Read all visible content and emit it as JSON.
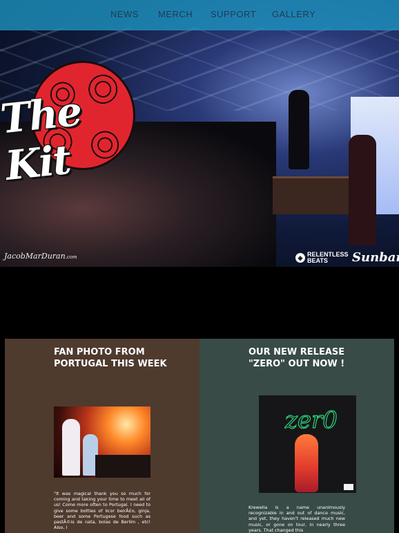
{
  "nav": {
    "items": [
      {
        "label": "NEWS"
      },
      {
        "label": "MERCH"
      },
      {
        "label": "SUPPORT"
      },
      {
        "label": "GALLERY"
      }
    ]
  },
  "hero": {
    "logo_text": "The Kit",
    "photo_credit": "JacobMarDuran",
    "photo_credit_suffix": ".com",
    "sponsor1_line1": "RELENTLESS",
    "sponsor1_line2": "BEATS",
    "sponsor2": "Sunbar"
  },
  "cards": [
    {
      "title": "FAN PHOTO FROM PORTUGAL THIS WEEK",
      "body": "\"It was magical thank you so much for coming and taking your time to meet all of us! Come more often to Portugal. I need to give some bottles of licor beirÃ£o, ginja, beer and some Portugese food such as pastÃ©is de nata, bolas de Berlim , etc! Also, I"
    },
    {
      "title": "OUR NEW RELEASE \"ZERO\" OUT NOW !",
      "album_text": "zer0",
      "body": "Krewella is a name unanimously recognizable in and out of dance music, and yet, they haven't released much new music, or gone on tour, in nearly three years. That changed this"
    }
  ],
  "colors": {
    "nav_bg": "#1e96c3",
    "card_left_bg": "#4f3a2e",
    "card_right_bg": "#384b46",
    "logo_red": "#e1252f"
  }
}
